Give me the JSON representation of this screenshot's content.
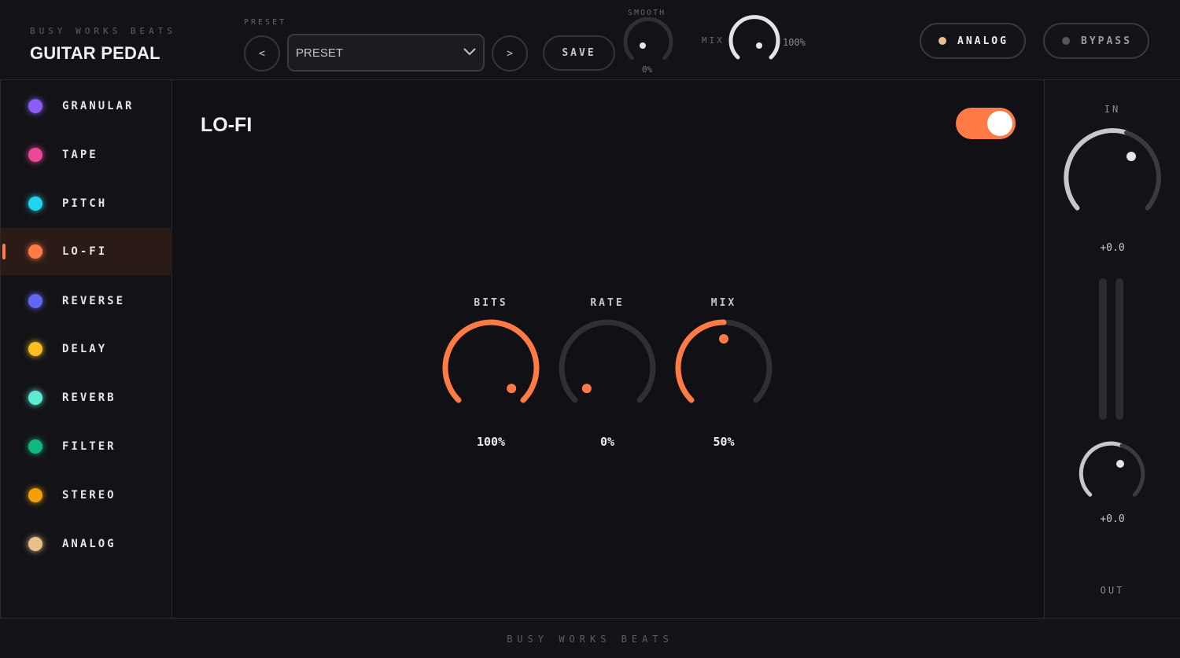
{
  "header": {
    "brand_sub": "BUSY WORKS BEATS",
    "title": "GUITAR PEDAL",
    "preset_label": "PRESET",
    "prev_label": "<",
    "preset_value": "PRESET",
    "next_label": ">",
    "save_label": "SAVE",
    "smooth_label": "SMOOTH",
    "smooth_value": "0%",
    "mix_label": "MIX",
    "mix_value": "100%",
    "analog_label": "ANALOG",
    "bypass_label": "BYPASS"
  },
  "sidebar": {
    "items": [
      {
        "label": "GRANULAR",
        "color": "#8b5cf6"
      },
      {
        "label": "TAPE",
        "color": "#ec4899"
      },
      {
        "label": "PITCH",
        "color": "#22d3ee"
      },
      {
        "label": "LO-FI",
        "color": "#ff7a45",
        "active": true
      },
      {
        "label": "REVERSE",
        "color": "#6366f1"
      },
      {
        "label": "DELAY",
        "color": "#fbbf24"
      },
      {
        "label": "REVERB",
        "color": "#5eead4"
      },
      {
        "label": "FILTER",
        "color": "#10b981"
      },
      {
        "label": "STEREO",
        "color": "#f59e0b"
      },
      {
        "label": "ANALOG",
        "color": "#e9c08a"
      }
    ]
  },
  "main": {
    "title": "LO-FI",
    "enabled": true,
    "accent": "#ff7a45",
    "knobs": [
      {
        "label": "BITS",
        "value": "100%",
        "fraction": 1.0
      },
      {
        "label": "RATE",
        "value": "0%",
        "fraction": 0.0
      },
      {
        "label": "MIX",
        "value": "50%",
        "fraction": 0.5
      }
    ]
  },
  "io": {
    "in_label": "IN",
    "in_value": "+0.0",
    "out_value": "+0.0",
    "out_label": "OUT"
  },
  "footer": {
    "text": "BUSY WORKS BEATS"
  }
}
